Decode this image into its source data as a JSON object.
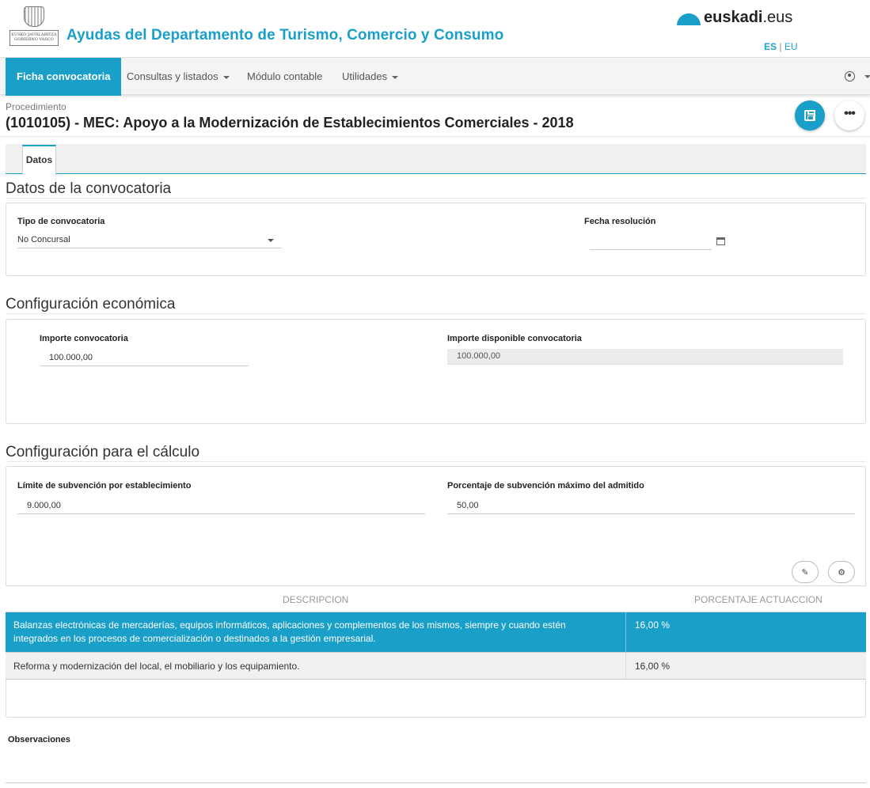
{
  "header": {
    "logo_text": "EUSKO JAURLARITZA GOBIERNO VASCO",
    "app_title": "Ayudas del Departamento de Turismo, Comercio y Consumo",
    "brand_bold": "euskadi",
    "brand_suffix": ".eus",
    "lang_es": "ES",
    "lang_sep": "|",
    "lang_eu": "EU"
  },
  "navbar": {
    "items": [
      {
        "label": "Ficha convocatoria",
        "active": true
      },
      {
        "label": "Consultas y listados",
        "dropdown": true
      },
      {
        "label": "Módulo contable"
      },
      {
        "label": "Utilidades",
        "dropdown": true
      }
    ]
  },
  "procedure": {
    "label": "Procedimiento",
    "title": "(1010105) - MEC: Apoyo a la Modernización de Establecimientos Comerciales - 2018",
    "more_label": "•••"
  },
  "tabs": [
    {
      "label": "Datos",
      "active": true
    }
  ],
  "section_datos": {
    "title": "Datos de la convocatoria",
    "tipo_label": "Tipo de convocatoria",
    "tipo_value": "No Concursal",
    "fecha_label": "Fecha resolución",
    "fecha_value": ""
  },
  "section_economica": {
    "title": "Configuración económica",
    "importe_label": "Importe convocatoria",
    "importe_value": "100.000,00",
    "disponible_label": "Importe disponible convocatoria",
    "disponible_value": "100.000,00"
  },
  "section_calculo": {
    "title": "Configuración para el cálculo",
    "limite_label": "Límite de subvención por establecimiento",
    "limite_value": "9.000,00",
    "porcentaje_label": "Porcentaje de subvención máximo del admitido",
    "porcentaje_value": "50,00",
    "edit_icon": "✎",
    "gear_icon": "⚙",
    "table": {
      "columns": [
        "DESCRIPCION",
        "PORCENTAJE ACTUACCION"
      ],
      "rows": [
        {
          "descripcion_1": "Balanzas electrónicas de mercaderías, equipos informáticos, aplicaciones y complementos de los mismos, siempre y cuando estén",
          "descripcion_2": "integrados en los procesos de comercialización o destinados a la gestión empresarial.",
          "porcentaje": "16,00 %",
          "selected": true
        },
        {
          "descripcion_1": "Reforma y modernización del local, el mobiliario y los equipamiento.",
          "descripcion_2": "",
          "porcentaje": "16,00 %",
          "selected": false
        }
      ]
    }
  },
  "observaciones": {
    "label": "Observaciones"
  },
  "colors": {
    "accent": "#1a9fc9"
  }
}
